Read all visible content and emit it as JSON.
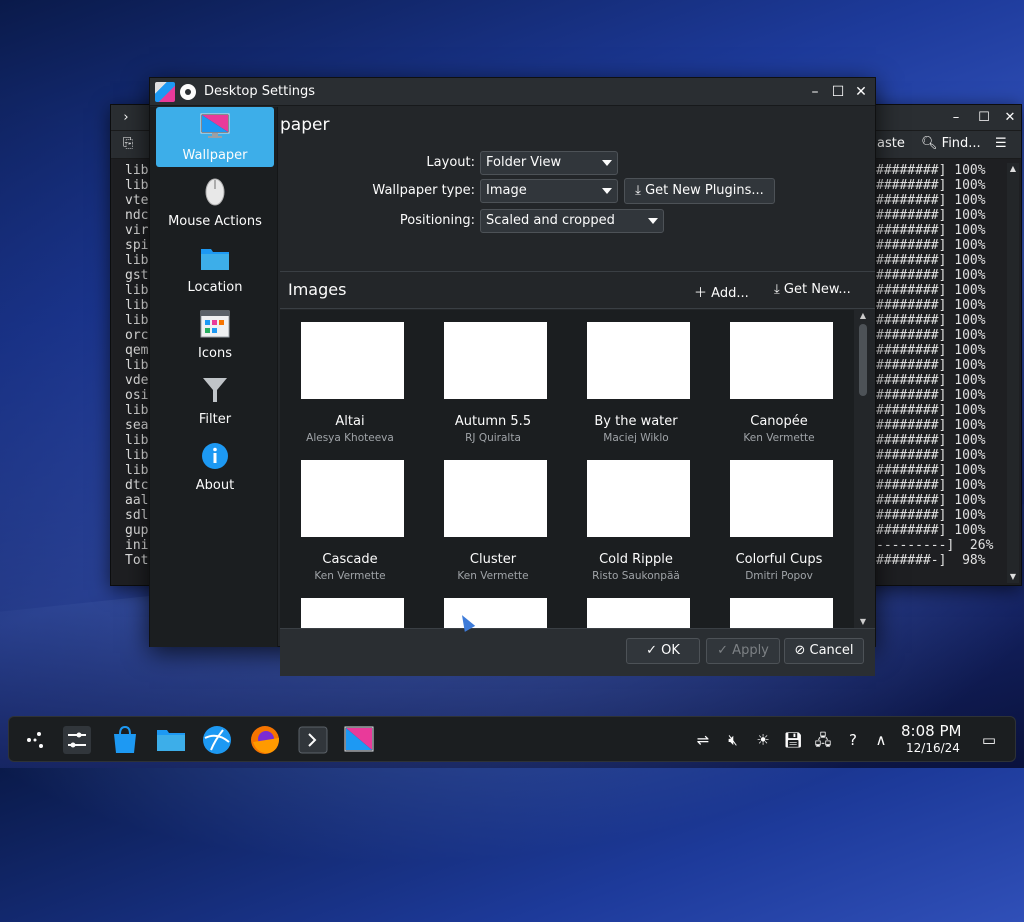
{
  "terminal": {
    "toolbar": {
      "paste_label": "aste",
      "find_label": "Find..."
    },
    "left_lines": [
      "lib",
      "lib",
      "vte",
      "ndc",
      "vir",
      "spi",
      "lib",
      "gst",
      "lib",
      "lib",
      "lib",
      "orc",
      "qem",
      "lib",
      "vde",
      "osi",
      "lib",
      "sea",
      "lib",
      "lib",
      "lib",
      "dtc",
      "aal",
      "sdl",
      "gup",
      "ini",
      "Tot"
    ],
    "right_lines": [
      "########] 100%",
      "########] 100%",
      "########] 100%",
      "########] 100%",
      "########] 100%",
      "########] 100%",
      "########] 100%",
      "########] 100%",
      "########] 100%",
      "########] 100%",
      "########] 100%",
      "########] 100%",
      "########] 100%",
      "########] 100%",
      "########] 100%",
      "########] 100%",
      "########] 100%",
      "########] 100%",
      "########] 100%",
      "########] 100%",
      "########] 100%",
      "########] 100%",
      "########] 100%",
      "########] 100%",
      "########] 100%",
      "---------]  26%",
      "#######-]  98%"
    ]
  },
  "dialog": {
    "title": "Desktop Settings",
    "sidebar": [
      {
        "label": "Wallpaper",
        "icon": "wallpaper-icon",
        "active": true
      },
      {
        "label": "Mouse Actions",
        "icon": "mouse-icon"
      },
      {
        "label": "Location",
        "icon": "folder-icon"
      },
      {
        "label": "Icons",
        "icon": "icons-icon"
      },
      {
        "label": "Filter",
        "icon": "filter-icon"
      },
      {
        "label": "About",
        "icon": "info-icon"
      }
    ],
    "page_heading": "paper",
    "form": {
      "layout_label": "Layout:",
      "layout_value": "Folder View",
      "type_label": "Wallpaper type:",
      "type_value": "Image",
      "plugins_button": "Get New Plugins...",
      "positioning_label": "Positioning:",
      "positioning_value": "Scaled and cropped"
    },
    "images_header": {
      "title": "Images",
      "add_label": "Add...",
      "get_new_label": "Get New..."
    },
    "images": [
      {
        "name": "Altai",
        "author": "Alesya Khoteeva"
      },
      {
        "name": "Autumn 5.5",
        "author": "RJ Quiralta"
      },
      {
        "name": "By the water",
        "author": "Maciej Wiklo"
      },
      {
        "name": "Canopée",
        "author": "Ken Vermette"
      },
      {
        "name": "Cascade",
        "author": "Ken Vermette"
      },
      {
        "name": "Cluster",
        "author": "Ken Vermette"
      },
      {
        "name": "Cold Ripple",
        "author": "Risto Saukonpää"
      },
      {
        "name": "Colorful Cups",
        "author": "Dmitri Popov"
      }
    ],
    "buttons": {
      "ok": "OK",
      "apply": "Apply",
      "cancel": "Cancel"
    }
  },
  "taskbar": {
    "clock_time": "8:08 PM",
    "clock_date": "12/16/24"
  },
  "colors": {
    "accent": "#3daee9",
    "window_bg": "#232629",
    "sidebar_bg": "#1b1e20"
  }
}
